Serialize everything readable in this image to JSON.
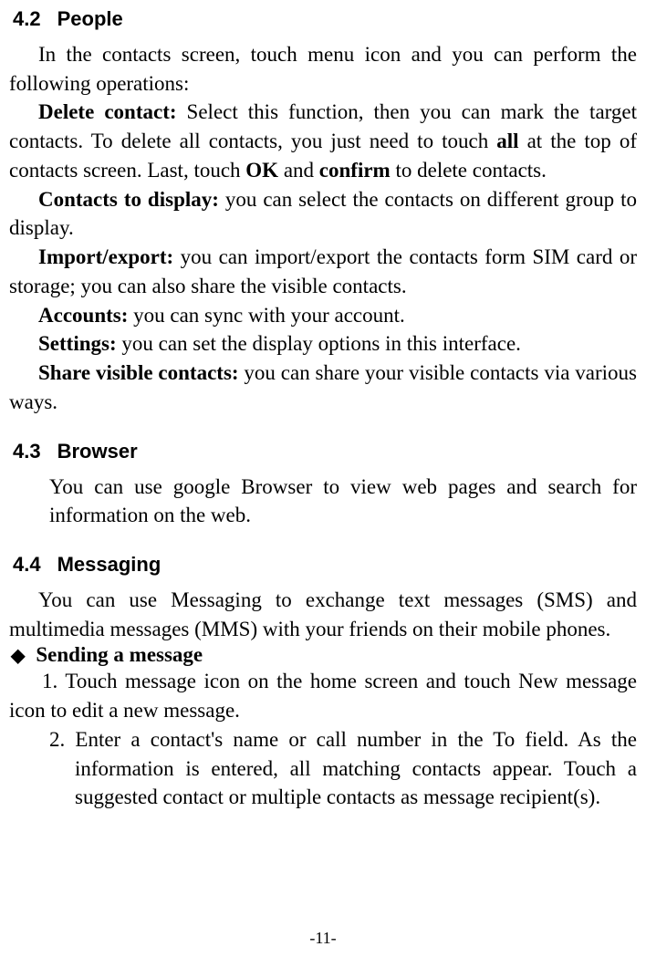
{
  "section42": {
    "number": "4.2",
    "title": "People",
    "intro": "In the contacts screen, touch menu icon and you can perform the following operations:",
    "deleteLabel": "Delete contact:",
    "deleteText1": " Select this function, then you can mark the target contacts. To delete all contacts, you just need to touch ",
    "deleteBold1": "all",
    "deleteText2": " at the top of contacts screen. Last, touch ",
    "deleteBold2": "OK",
    "deleteText3": " and ",
    "deleteBold3": "confirm",
    "deleteText4": " to delete contacts.",
    "contactsDisplayLabel": "Contacts to display:",
    "contactsDisplayText": " you can select the contacts on different group to display.",
    "importLabel": "Import/export:",
    "importText": " you can import/export the contacts form SIM card or storage; you can also share the visible contacts.",
    "accountsLabel": "Accounts:",
    "accountsText": " you can sync with your account.",
    "settingsLabel": "Settings:",
    "settingsText": " you can set the display options in this interface.",
    "shareLabel": "Share visible contacts:",
    "shareText": " you can share your visible contacts via various ways."
  },
  "section43": {
    "number": "4.3",
    "title": "Browser",
    "text": "You can use google Browser to view web pages and search for information on the web."
  },
  "section44": {
    "number": "4.4",
    "title": "Messaging",
    "intro": "You can use Messaging to exchange text messages (SMS) and multimedia messages (MMS) with your friends on their mobile phones.",
    "bulletHeading": "Sending a message",
    "item1Prefix": "1.  ",
    "item1Text": "Touch message icon on the home screen and touch New message icon to edit a new message.",
    "item2Prefix": "2.  ",
    "item2Text": "Enter a contact's name or call number in the To field. As the information is entered, all matching contacts appear. Touch a suggested contact or multiple contacts as message recipient(s)."
  },
  "footer": "-11-"
}
